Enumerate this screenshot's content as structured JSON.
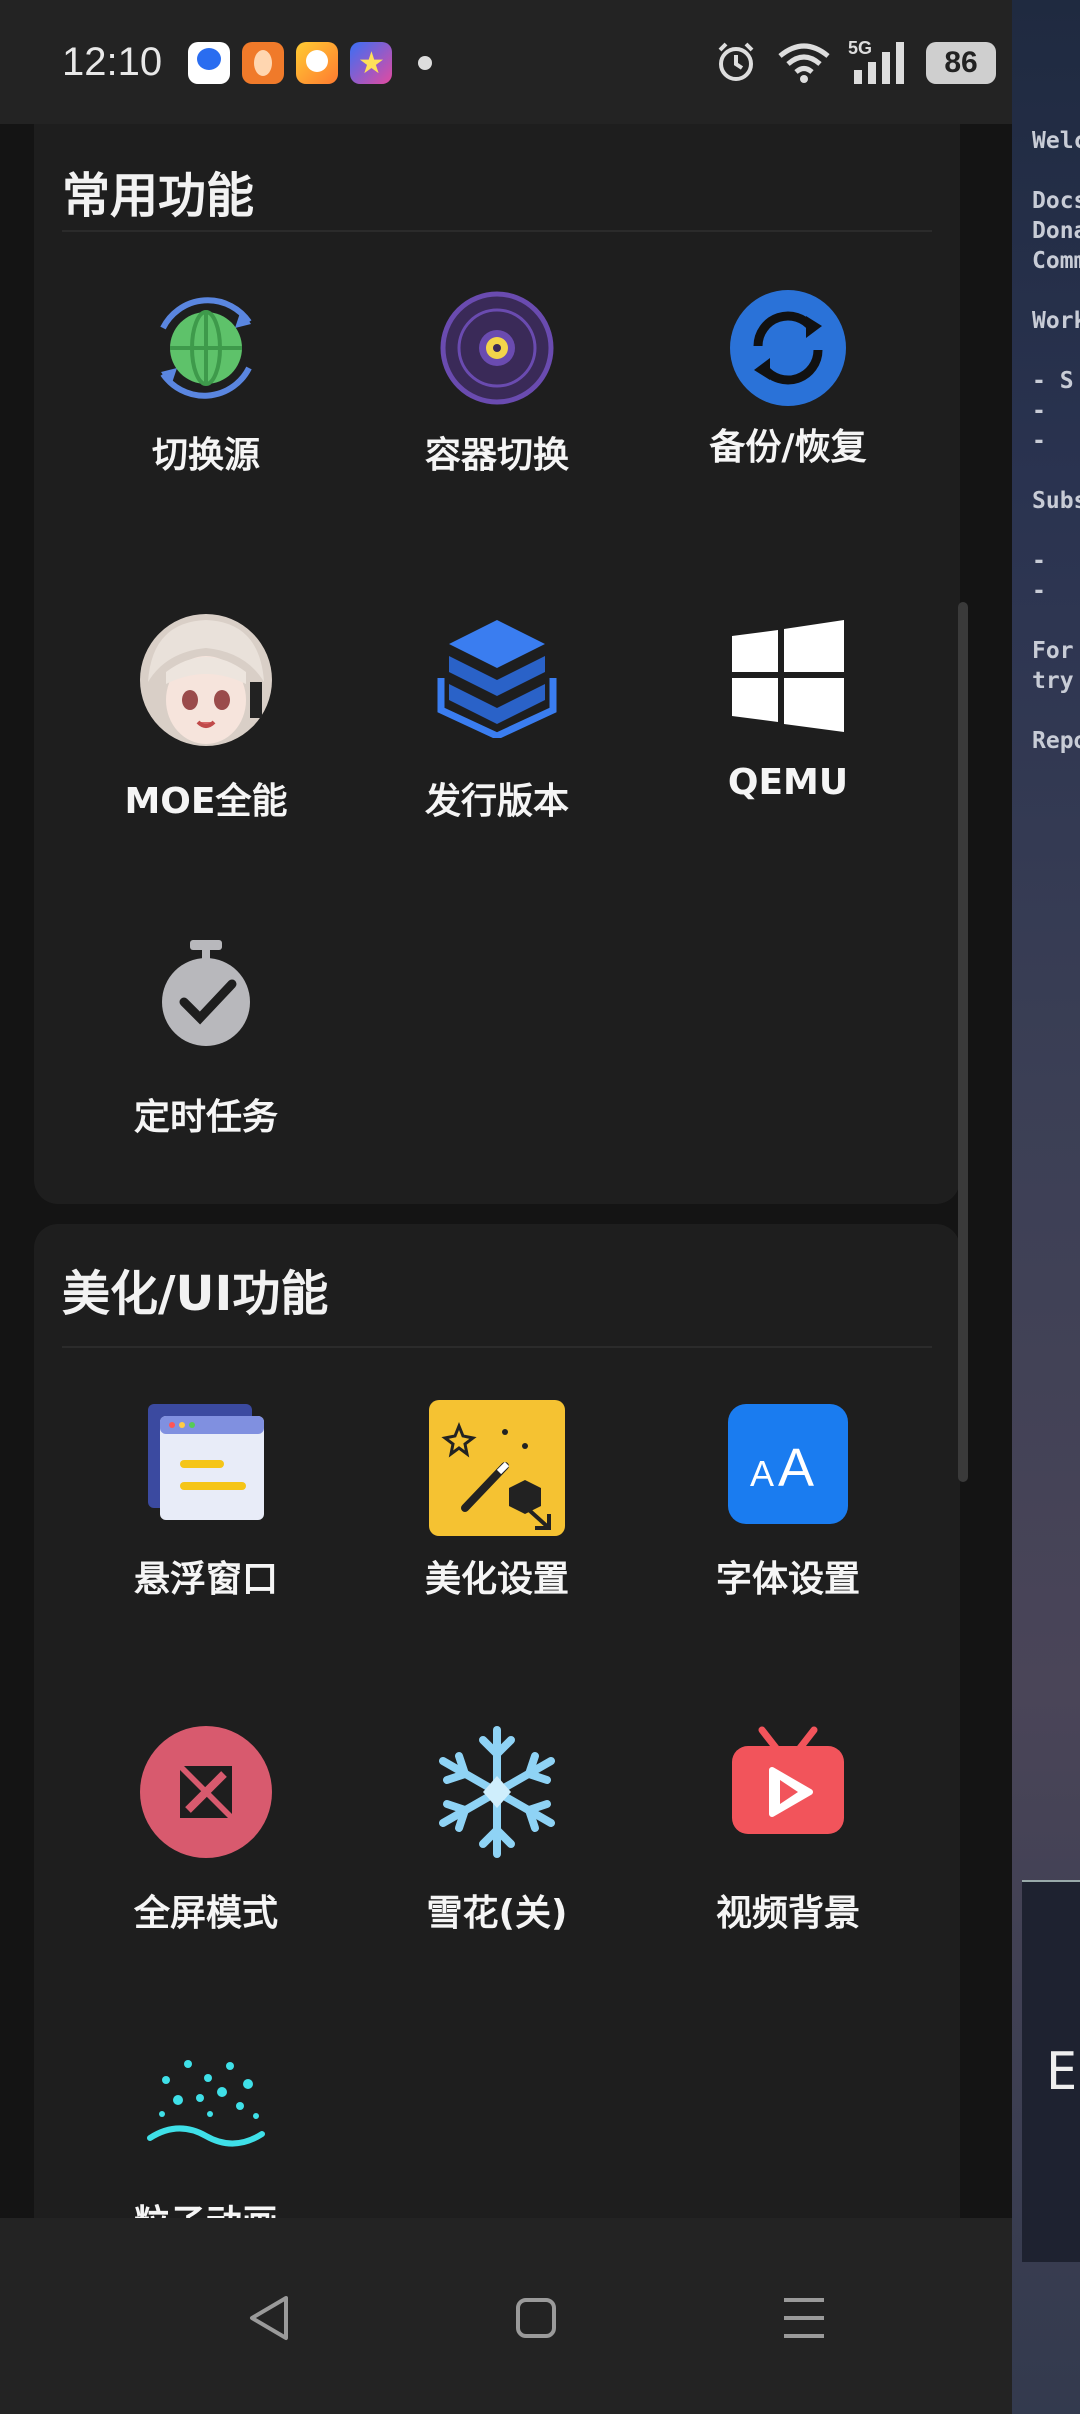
{
  "status_bar": {
    "time": "12:10",
    "network": "5G",
    "battery": "86"
  },
  "sections": {
    "common": {
      "title": "常用功能",
      "items": [
        {
          "label": "切换源",
          "icon": "globe-sync-icon"
        },
        {
          "label": "容器切换",
          "icon": "disc-icon"
        },
        {
          "label": "备份/恢复",
          "icon": "sync-icon"
        },
        {
          "label": "MOE全能",
          "icon": "anime-avatar-icon"
        },
        {
          "label": "发行版本",
          "icon": "stack-icon"
        },
        {
          "label": "QEMU",
          "icon": "windows-icon"
        },
        {
          "label": "定时任务",
          "icon": "stopwatch-check-icon"
        }
      ]
    },
    "ui": {
      "title": "美化/UI功能",
      "items": [
        {
          "label": "悬浮窗口",
          "icon": "floating-window-icon"
        },
        {
          "label": "美化设置",
          "icon": "magic-wand-icon"
        },
        {
          "label": "字体设置",
          "icon": "font-icon"
        },
        {
          "label": "全屏模式",
          "icon": "fullscreen-icon"
        },
        {
          "label": "雪花(关)",
          "icon": "snowflake-icon"
        },
        {
          "label": "视频背景",
          "icon": "video-play-icon"
        },
        {
          "label": "粒子动画",
          "icon": "particles-icon"
        }
      ]
    }
  },
  "background_terminal": {
    "lines": [
      "Welc",
      "Docs",
      "Dona",
      "Comm",
      "Work",
      "- S",
      "- ",
      "- ",
      "Subs",
      "- ",
      "- ",
      "For",
      "try",
      "Repo"
    ],
    "card_text": "ES"
  },
  "colors": {
    "panel": "#1e1e1e",
    "background": "#141414",
    "bar": "#232323"
  }
}
